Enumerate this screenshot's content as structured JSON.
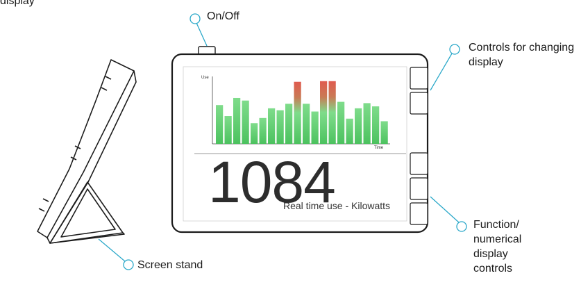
{
  "header_fragment": "display",
  "callouts": {
    "on_off": "On/Off",
    "controls_display": "Controls for changing display",
    "function_controls": "Function/ numerical display controls",
    "screen_stand": "Screen stand"
  },
  "screen": {
    "reading": "1084",
    "caption": "Real time use - Kilowatts"
  },
  "chart_data": {
    "type": "bar",
    "xlabel": "Time",
    "ylabel": "Use",
    "ylim": [
      0,
      1
    ],
    "values": [
      0.6,
      0.43,
      0.71,
      0.67,
      0.32,
      0.4,
      0.55,
      0.52,
      0.62,
      0.96,
      0.62,
      0.5,
      0.97,
      0.97,
      0.65,
      0.39,
      0.55,
      0.63,
      0.58,
      0.35
    ],
    "peak_threshold": 0.86,
    "colors": {
      "normal": "#6cd07a",
      "peak": "#d9534f",
      "normal_dark": "#3fa653"
    }
  },
  "colors": {
    "outline": "#1c1c1c",
    "callout_ring": "#2aa8c9",
    "callout_line": "#2aa8c9"
  },
  "icons": {
    "callout_marker": "circle-ring-icon"
  }
}
